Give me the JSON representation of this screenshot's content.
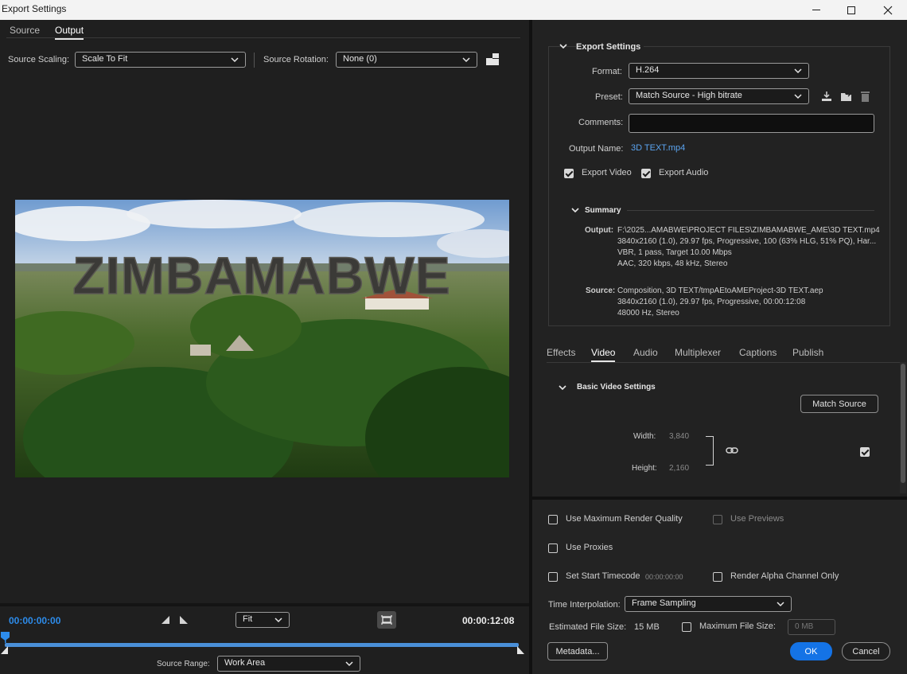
{
  "window": {
    "title": "Export Settings"
  },
  "left": {
    "tabs": [
      {
        "label": "Source"
      },
      {
        "label": "Output"
      }
    ],
    "source_scaling_label": "Source Scaling:",
    "source_scaling_value": "Scale To Fit",
    "source_rotation_label": "Source Rotation:",
    "source_rotation_value": "None (0)",
    "preview_text": "ZIMBAMABWE",
    "timecode_start": "00:00:00:00",
    "timecode_end": "00:00:12:08",
    "zoom_value": "Fit",
    "source_range_label": "Source Range:",
    "source_range_value": "Work Area",
    "playhead_fraction": 0
  },
  "export_settings": {
    "header": "Export Settings",
    "format_label": "Format:",
    "format_value": "H.264",
    "preset_label": "Preset:",
    "preset_value": "Match Source - High bitrate",
    "comments_label": "Comments:",
    "comments_value": "",
    "output_name_label": "Output Name:",
    "output_name_value": "3D TEXT.mp4",
    "export_video_label": "Export Video",
    "export_video_checked": true,
    "export_audio_label": "Export Audio",
    "export_audio_checked": true
  },
  "summary": {
    "header": "Summary",
    "output_label": "Output:",
    "output_lines": [
      "F:\\2025...AMABWE\\PROJECT FILES\\ZIMBAMABWE_AME\\3D TEXT.mp4",
      "3840x2160 (1.0), 29.97 fps, Progressive, 100 (63% HLG, 51% PQ), Har...",
      "VBR, 1 pass, Target 10.00 Mbps",
      "AAC, 320 kbps, 48 kHz, Stereo"
    ],
    "source_label": "Source:",
    "source_lines": [
      "Composition, 3D TEXT/tmpAEtoAMEProject-3D TEXT.aep",
      "3840x2160 (1.0), 29.97 fps, Progressive, 00:00:12:08",
      "48000 Hz, Stereo"
    ]
  },
  "settings_tabs": [
    {
      "label": "Effects"
    },
    {
      "label": "Video"
    },
    {
      "label": "Audio"
    },
    {
      "label": "Multiplexer"
    },
    {
      "label": "Captions"
    },
    {
      "label": "Publish"
    }
  ],
  "basic_video": {
    "header": "Basic Video Settings",
    "match_source_label": "Match Source",
    "width_label": "Width:",
    "width_value": "3,840",
    "height_label": "Height:",
    "height_value": "2,160"
  },
  "bottom": {
    "max_render_quality": "Use Maximum Render Quality",
    "use_previews": "Use Previews",
    "use_proxies": "Use Proxies",
    "set_start_timecode": "Set Start Timecode",
    "start_timecode_value": "00:00:00:00",
    "render_alpha": "Render Alpha Channel Only",
    "time_interp_label": "Time Interpolation:",
    "time_interp_value": "Frame Sampling",
    "est_file_size_label": "Estimated File Size:",
    "est_file_size_value": "15 MB",
    "max_file_size_label": "Maximum File Size:",
    "max_file_size_value": "0 MB",
    "metadata_label": "Metadata...",
    "ok_label": "OK",
    "cancel_label": "Cancel"
  }
}
